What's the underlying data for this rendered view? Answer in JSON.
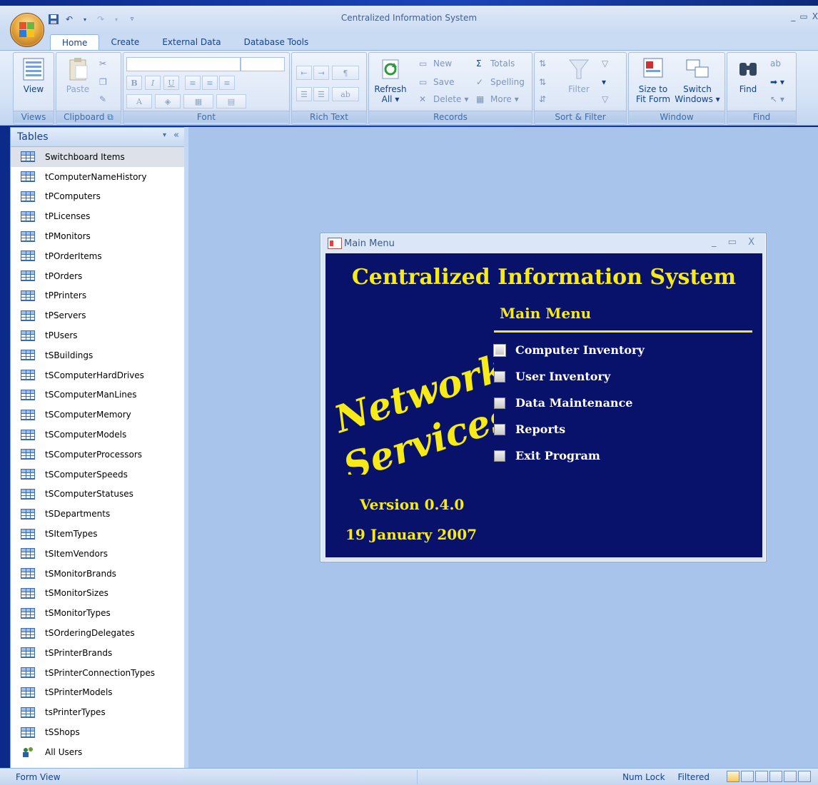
{
  "window": {
    "title": "Centralized Information System",
    "controls": [
      "_",
      "▭",
      "X"
    ]
  },
  "ribbon": {
    "tabs": [
      "Home",
      "Create",
      "External Data",
      "Database Tools"
    ],
    "groups": {
      "views": {
        "label": "Views",
        "view": "View"
      },
      "clipboard": {
        "label": "Clipboard",
        "paste": "Paste"
      },
      "font": {
        "label": "Font",
        "bold": "B",
        "italic": "I",
        "underline": "U",
        "fontcolor": "A"
      },
      "richtext": {
        "label": "Rich Text"
      },
      "records": {
        "label": "Records",
        "refresh": "Refresh",
        "refresh_all": "All",
        "new": "New",
        "save": "Save",
        "delete": "Delete",
        "totals": "Totals",
        "spelling": "Spelling",
        "more": "More"
      },
      "sortfilter": {
        "label": "Sort & Filter",
        "filter": "Filter"
      },
      "window": {
        "label": "Window",
        "size_to": "Size to",
        "fit_form": "Fit Form",
        "switch": "Switch",
        "windows": "Windows"
      },
      "find": {
        "label": "Find",
        "find": "Find"
      }
    }
  },
  "nav": {
    "header": "Tables",
    "items": [
      {
        "label": "Switchboard Items",
        "icon": "table-icon"
      },
      {
        "label": "tComputerNameHistory",
        "icon": "table-icon"
      },
      {
        "label": "tPComputers",
        "icon": "table-icon"
      },
      {
        "label": "tPLicenses",
        "icon": "table-icon"
      },
      {
        "label": "tPMonitors",
        "icon": "table-icon"
      },
      {
        "label": "tPOrderItems",
        "icon": "table-icon"
      },
      {
        "label": "tPOrders",
        "icon": "table-icon"
      },
      {
        "label": "tPPrinters",
        "icon": "table-icon"
      },
      {
        "label": "tPServers",
        "icon": "table-icon"
      },
      {
        "label": "tPUsers",
        "icon": "table-icon"
      },
      {
        "label": "tSBuildings",
        "icon": "table-icon"
      },
      {
        "label": "tSComputerHardDrives",
        "icon": "table-icon"
      },
      {
        "label": "tSComputerManLines",
        "icon": "table-icon"
      },
      {
        "label": "tSComputerMemory",
        "icon": "table-icon"
      },
      {
        "label": "tSComputerModels",
        "icon": "table-icon"
      },
      {
        "label": "tSComputerProcessors",
        "icon": "table-icon"
      },
      {
        "label": "tSComputerSpeeds",
        "icon": "table-icon"
      },
      {
        "label": "tSComputerStatuses",
        "icon": "table-icon"
      },
      {
        "label": "tSDepartments",
        "icon": "table-icon"
      },
      {
        "label": "tSItemTypes",
        "icon": "table-icon"
      },
      {
        "label": "tSItemVendors",
        "icon": "table-icon"
      },
      {
        "label": "tSMonitorBrands",
        "icon": "table-icon"
      },
      {
        "label": "tSMonitorSizes",
        "icon": "table-icon"
      },
      {
        "label": "tSMonitorTypes",
        "icon": "table-icon"
      },
      {
        "label": "tSOrderingDelegates",
        "icon": "table-icon"
      },
      {
        "label": "tSPrinterBrands",
        "icon": "table-icon"
      },
      {
        "label": "tSPrinterConnectionTypes",
        "icon": "table-icon"
      },
      {
        "label": "tSPrinterModels",
        "icon": "table-icon"
      },
      {
        "label": "tsPrinterTypes",
        "icon": "table-icon"
      },
      {
        "label": "tSShops",
        "icon": "table-icon"
      },
      {
        "label": "All Users",
        "icon": "users-icon"
      }
    ]
  },
  "form": {
    "window_title": "Main Menu",
    "title": "Centralized Information System",
    "subtitle": "Main Menu",
    "logo_line1": "Network",
    "logo_line2": "Services",
    "menu_items": [
      "Computer Inventory",
      "User Inventory",
      "Data Maintenance",
      "Reports",
      "Exit Program"
    ],
    "version": "Version 0.4.0",
    "date": "19 January 2007",
    "colors": {
      "background": "#08126b",
      "accent": "#f6ea18",
      "text": "#ffffff"
    }
  },
  "status": {
    "left": "Form View",
    "num_lock": "Num Lock",
    "filtered": "Filtered"
  }
}
